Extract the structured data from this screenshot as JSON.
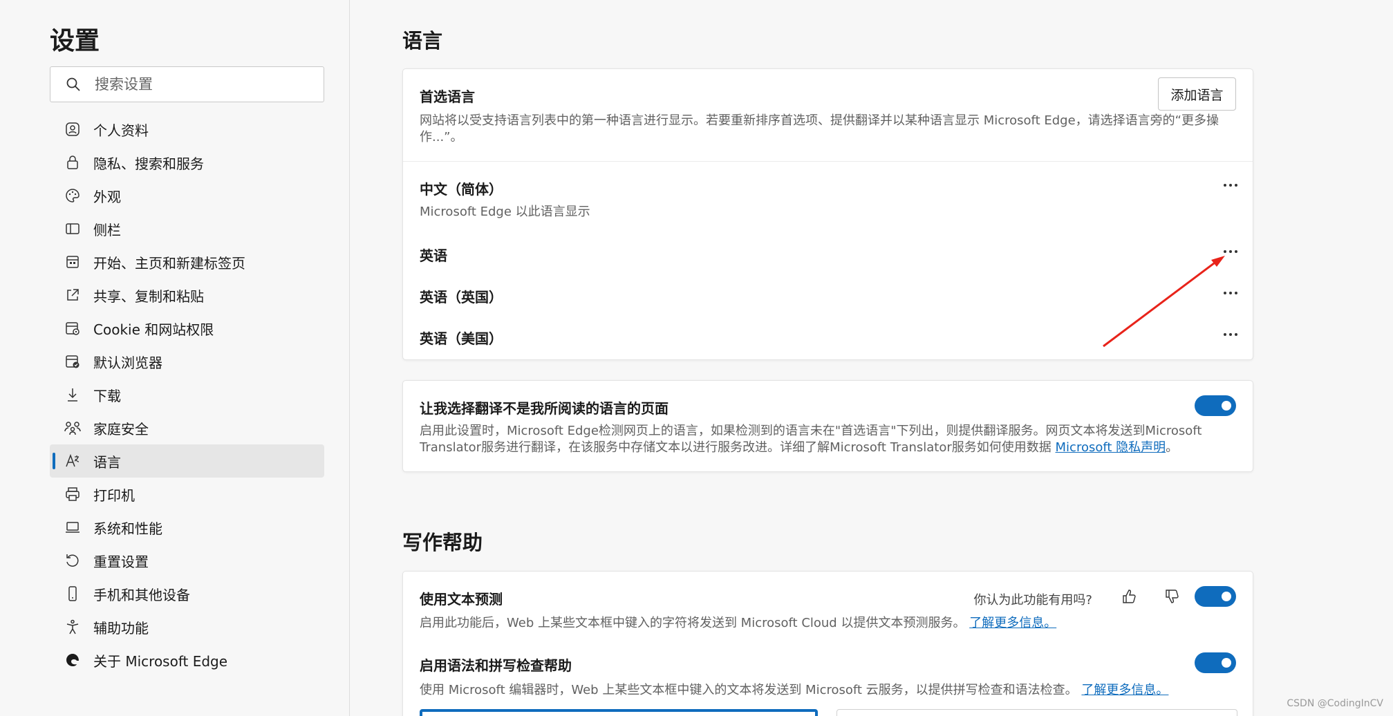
{
  "sidebar": {
    "title": "设置",
    "search_placeholder": "搜索设置",
    "items": [
      {
        "label": "个人资料",
        "icon": "profile-icon"
      },
      {
        "label": "隐私、搜索和服务",
        "icon": "lock-icon"
      },
      {
        "label": "外观",
        "icon": "palette-icon"
      },
      {
        "label": "侧栏",
        "icon": "sidebar-icon"
      },
      {
        "label": "开始、主页和新建标签页",
        "icon": "home-icon"
      },
      {
        "label": "共享、复制和粘贴",
        "icon": "share-icon"
      },
      {
        "label": "Cookie 和网站权限",
        "icon": "cookie-icon"
      },
      {
        "label": "默认浏览器",
        "icon": "browser-icon"
      },
      {
        "label": "下载",
        "icon": "download-icon"
      },
      {
        "label": "家庭安全",
        "icon": "family-icon"
      },
      {
        "label": "语言",
        "icon": "language-icon",
        "active": true
      },
      {
        "label": "打印机",
        "icon": "printer-icon"
      },
      {
        "label": "系统和性能",
        "icon": "laptop-icon"
      },
      {
        "label": "重置设置",
        "icon": "reset-icon"
      },
      {
        "label": "手机和其他设备",
        "icon": "phone-icon"
      },
      {
        "label": "辅助功能",
        "icon": "accessibility-icon"
      },
      {
        "label": "关于 Microsoft Edge",
        "icon": "edge-icon"
      }
    ]
  },
  "language": {
    "section_title": "语言",
    "preferred_title": "首选语言",
    "preferred_desc_1": "网站将以受支持语言列表中的第一种语言进行显示。若要重新排序首选项、提供翻译并以某种语言显示 Microsoft Edge，请选择语言旁的“更多操",
    "preferred_desc_2": "作...”。",
    "add_button": "添加语言",
    "languages": [
      {
        "name": "中文（简体）",
        "note": "Microsoft Edge 以此语言显示"
      },
      {
        "name": "英语"
      },
      {
        "name": "英语（英国）"
      },
      {
        "name": "英语（美国）"
      }
    ],
    "translate_title": "让我选择翻译不是我所阅读的语言的页面",
    "translate_desc_1": "启用此设置时，Microsoft Edge检测网页上的语言，如果检测到的语言未在\"首选语言\"下列出，则提供翻译服务。网页文本将发送到Microsoft",
    "translate_desc_2": "Translator服务进行翻译，在该服务中存储文本以进行服务改进。详细了解Microsoft Translator服务如何使用数据",
    "translate_link": "Microsoft 隐私声明",
    "translate_period": "。"
  },
  "writing": {
    "section_title": "写作帮助",
    "prediction_title": "使用文本预测",
    "feedback_question": "你认为此功能有用吗?",
    "prediction_desc": "启用此功能后，Web 上某些文本框中键入的字符将发送到 Microsoft Cloud 以提供文本预测服务。",
    "prediction_link": "了解更多信息。",
    "grammar_title": "启用语法和拼写检查帮助",
    "grammar_desc": "使用 Microsoft 编辑器时，Web 上某些文本框中键入的文本将发送到 Microsoft 云服务，以提供拼写检查和语法检查。",
    "grammar_link": "了解更多信息。"
  },
  "watermark": "CSDN @CodingInCV",
  "colors": {
    "accent": "#0f6cbd",
    "annotation": "#e8231a"
  }
}
